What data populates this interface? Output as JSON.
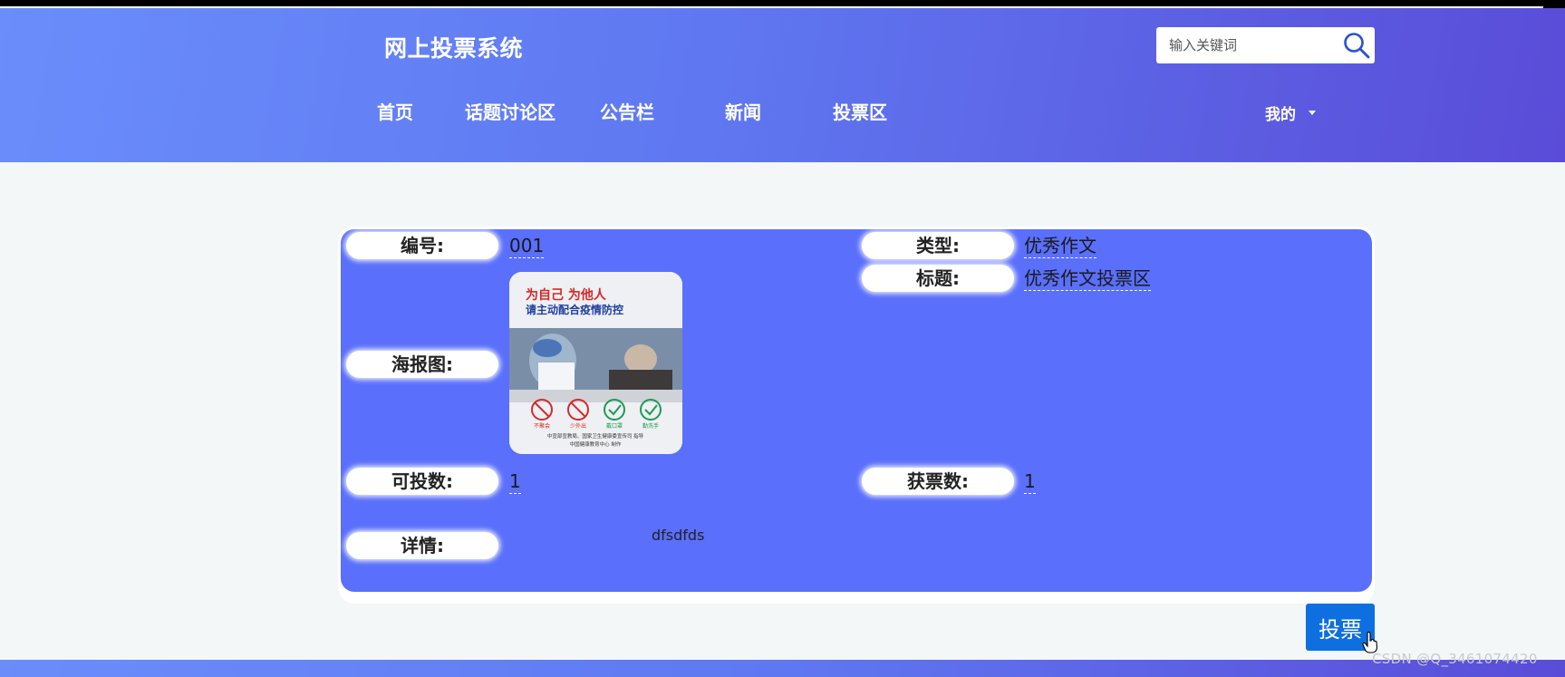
{
  "header": {
    "site_title": "网上投票系统",
    "search": {
      "placeholder": "输入关键词",
      "icon": "search-icon"
    },
    "nav": [
      "首页",
      "话题讨论区",
      "公告栏",
      "新闻",
      "投票区"
    ],
    "user_menu": "我的"
  },
  "detail": {
    "labels": {
      "id": "编号:",
      "type": "类型:",
      "title": "标题:",
      "poster": "海报图:",
      "votable": "可投数:",
      "votes": "获票数:",
      "details": "详情:"
    },
    "values": {
      "id": "001",
      "type": "优秀作文",
      "title": "优秀作文投票区",
      "votable": "1",
      "votes": "1",
      "details": "dfsdfds"
    },
    "poster": {
      "line1": "为自己 为他人",
      "line2": "请主动配合疫情防控",
      "icons": [
        "不聚会",
        "少外出",
        "戴口罩",
        "勤洗手"
      ],
      "credit1": "中宣部宣教局、国家卫生健康委宣传司 指导",
      "credit2": "中国健康教育中心 制作"
    }
  },
  "actions": {
    "vote": "投票"
  },
  "watermark": "CSDN @Q_3461074420",
  "colors": {
    "header_start": "#6a8dfb",
    "header_end": "#5a4cd8",
    "card": "#5a6ffb",
    "button": "#0d6fe0"
  }
}
